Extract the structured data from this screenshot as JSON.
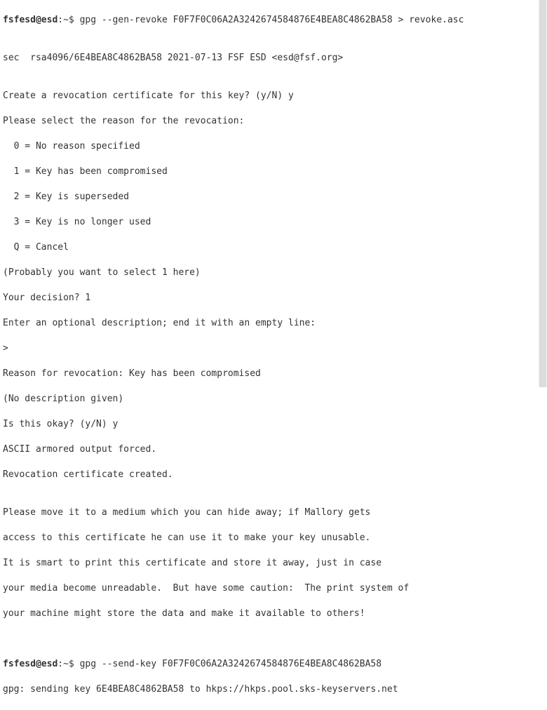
{
  "prompt1": {
    "userhost": "fsfesd@esd",
    "path": ":~$ ",
    "command": "gpg --gen-revoke F0F7F0C06A2A3242674584876E4BEA8C4862BA58 > revoke.asc"
  },
  "blank1": "",
  "sec_line": "sec  rsa4096/6E4BEA8C4862BA58 2021-07-13 FSF ESD <esd@fsf.org>",
  "blank2": "",
  "create_q": "Create a revocation certificate for this key? (y/N) y",
  "select_reason": "Please select the reason for the revocation:",
  "opt0": "  0 = No reason specified",
  "opt1": "  1 = Key has been compromised",
  "opt2": "  2 = Key is superseded",
  "opt3": "  3 = Key is no longer used",
  "optQ": "  Q = Cancel",
  "probably": "(Probably you want to select 1 here)",
  "decision": "Your decision? 1",
  "enter_desc": "Enter an optional description; end it with an empty line:",
  "desc_prompt": ">",
  "reason_line": "Reason for revocation: Key has been compromised",
  "no_desc": "(No description given)",
  "is_okay": "Is this okay? (y/N) y",
  "ascii_forced": "ASCII armored output forced.",
  "rev_created": "Revocation certificate created.",
  "blank3": "",
  "advice1": "Please move it to a medium which you can hide away; if Mallory gets",
  "advice2": "access to this certificate he can use it to make your key unusable.",
  "advice3": "It is smart to print this certificate and store it away, just in case",
  "advice4": "your media become unreadable.  But have some caution:  The print system of",
  "advice5": "your machine might store the data and make it available to others!",
  "blank4": "",
  "blank5": "",
  "prompt2": {
    "userhost": "fsfesd@esd",
    "path": ":~$ ",
    "command": "gpg --send-key F0F7F0C06A2A3242674584876E4BEA8C4862BA58"
  },
  "sending": "gpg: sending key 6E4BEA8C4862BA58 to hkps://hkps.pool.sks-keyservers.net"
}
